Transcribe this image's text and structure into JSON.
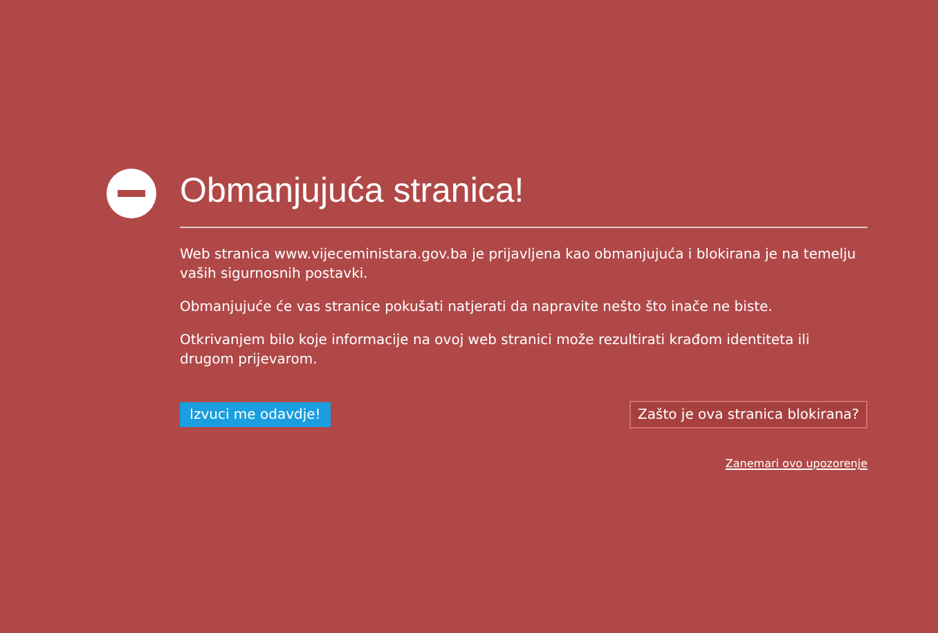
{
  "title": "Obmanjujuća stranica!",
  "paragraphs": [
    "Web stranica www.vijeceministara.gov.ba je prijavljena kao obmanjujuća i blokirana je na temelju vaših sigurnosnih postavki.",
    "Obmanjujuće će vas stranice pokušati natjerati da napravite nešto što inače ne biste.",
    "Otkrivanjem bilo koje informacije na ovoj web stranici može rezultirati krađom identiteta ili drugom prijevarom."
  ],
  "primary_button": "Izvuci me odavdje!",
  "secondary_button": "Zašto je ova stranica blokirana?",
  "ignore_link": "Zanemari ovo upozorenje"
}
